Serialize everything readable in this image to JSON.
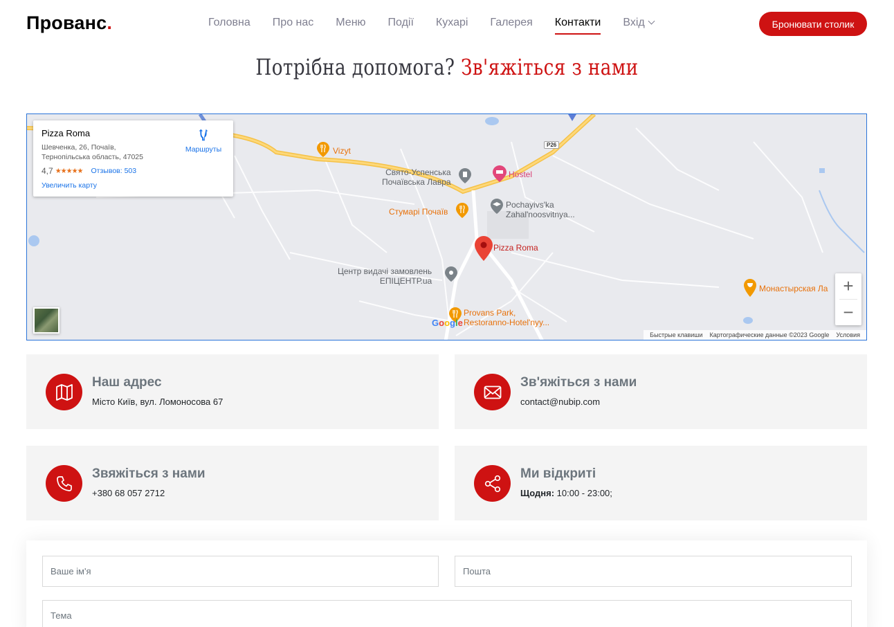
{
  "header": {
    "logo_text": "Прованс",
    "logo_dot": ".",
    "nav": [
      {
        "label": "Головна",
        "active": false
      },
      {
        "label": "Про нас",
        "active": false
      },
      {
        "label": "Меню",
        "active": false
      },
      {
        "label": "Події",
        "active": false
      },
      {
        "label": "Кухарі",
        "active": false
      },
      {
        "label": "Галерея",
        "active": false
      },
      {
        "label": "Контакти",
        "active": true
      },
      {
        "label": "Вхід",
        "active": false,
        "dropdown": true
      }
    ],
    "book_button": "Бронювати столик",
    "accent_color": "#ce1212"
  },
  "section": {
    "title_plain": "Потрібна допомога?",
    "title_accent": "Зв'яжіться з нами"
  },
  "map": {
    "place_name": "Pizza Roma",
    "address_line1": "Шевченка, 26, Почаїв,",
    "address_line2": "Тернопільська область, 47025",
    "rating": "4,7",
    "stars": "★★★★★",
    "reviews": "Отзывов: 503",
    "enlarge_link": "Увеличить карту",
    "routes_label": "Маршруты",
    "labels": {
      "vizyt": "Vizyt",
      "lavra": "Свято-Успенська\nПочаївська Лавра",
      "hostel": "Hostel",
      "stumari": "Стумарі Почаїв",
      "school": "Pochayivs'ka\nZahal'noosvitnya...",
      "pizza_roma": "Pizza Roma",
      "epicentr": "Центр видачі замовлень\nЕПІЦЕНТР.ua",
      "provans_park": "Provans Park,\nRestoranno-Hotel'nyy...",
      "monastery": "Монастырская Ла",
      "road_badge": "P26"
    },
    "google_logo": "Google",
    "attribution": [
      "Быстрые клавиши",
      "Картографические данные ©2023 Google",
      "Условия"
    ],
    "zoom_in": "+",
    "zoom_out": "−"
  },
  "info_boxes": [
    {
      "title": "Наш адрес",
      "text": "Місто Київ, вул. Ломоносова 67",
      "icon": "map-icon"
    },
    {
      "title": "Зв'яжіться з нами",
      "text": "contact@nubip.com",
      "icon": "envelope-icon"
    },
    {
      "title": "Звяжіться з нами",
      "text": "+380 68 057 2712",
      "icon": "phone-icon"
    },
    {
      "title": "Ми відкриті",
      "text_bold": "Щодня:",
      "text": " 10:00 - 23:00;",
      "icon": "share-icon"
    }
  ],
  "form": {
    "name_placeholder": "Ваше ім'я",
    "email_placeholder": "Пошта",
    "subject_placeholder": "Тема"
  }
}
